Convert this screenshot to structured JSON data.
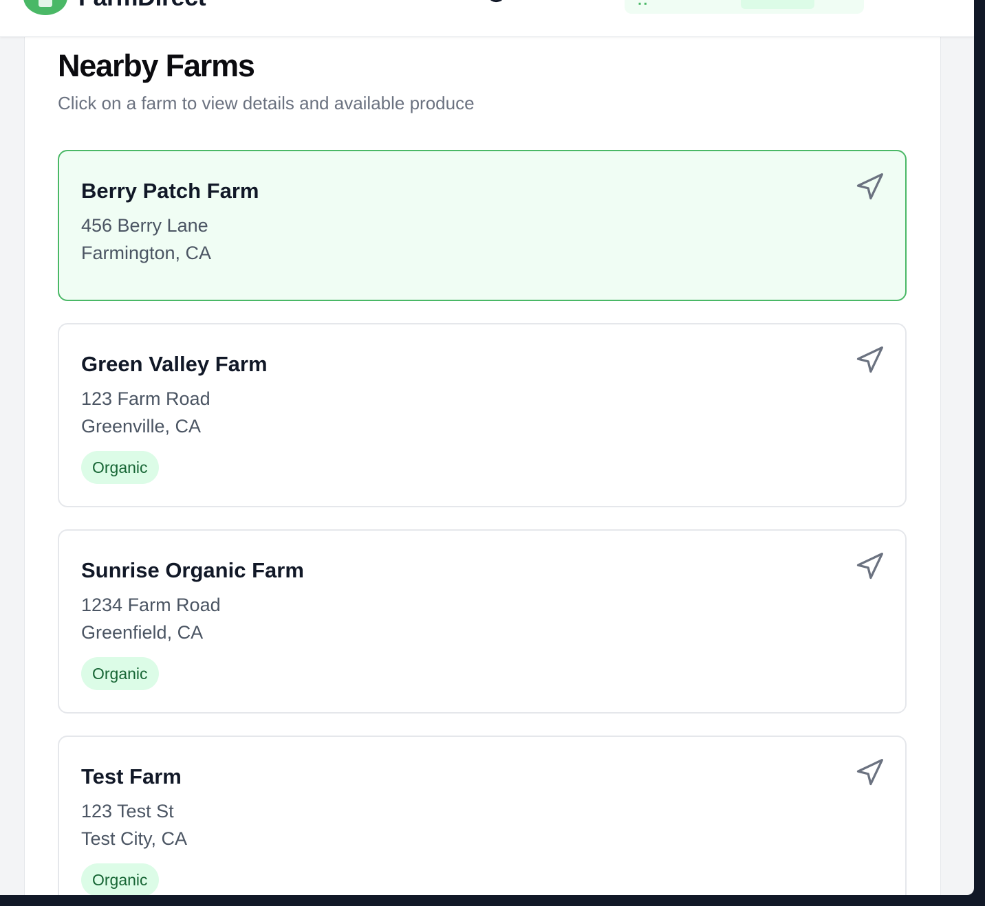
{
  "app": {
    "name": "FarmDirect",
    "brand_color": "#4ab866"
  },
  "page": {
    "title": "Nearby Farms",
    "subtitle": "Click on a farm to view details and available produce"
  },
  "farms": [
    {
      "name": "Berry Patch Farm",
      "address": "456 Berry Lane",
      "city": "Farmington, CA",
      "badge": "",
      "selected": true
    },
    {
      "name": "Green Valley Farm",
      "address": "123 Farm Road",
      "city": "Greenville, CA",
      "badge": "Organic",
      "selected": false
    },
    {
      "name": "Sunrise Organic Farm",
      "address": "1234 Farm Road",
      "city": "Greenfield, CA",
      "badge": "Organic",
      "selected": false
    },
    {
      "name": "Test Farm",
      "address": "123 Test St",
      "city": "Test City, CA",
      "badge": "Organic",
      "selected": false
    }
  ],
  "icons": {
    "directions": "navigation-arrow-icon",
    "chat": "chat-icon",
    "cart": "cart-icon",
    "logo": "farm-logo-icon"
  },
  "colors": {
    "selected_background": "#f0fdf4",
    "selected_border": "#4ab866",
    "badge_background": "#dcfce7",
    "badge_text": "#166534"
  }
}
